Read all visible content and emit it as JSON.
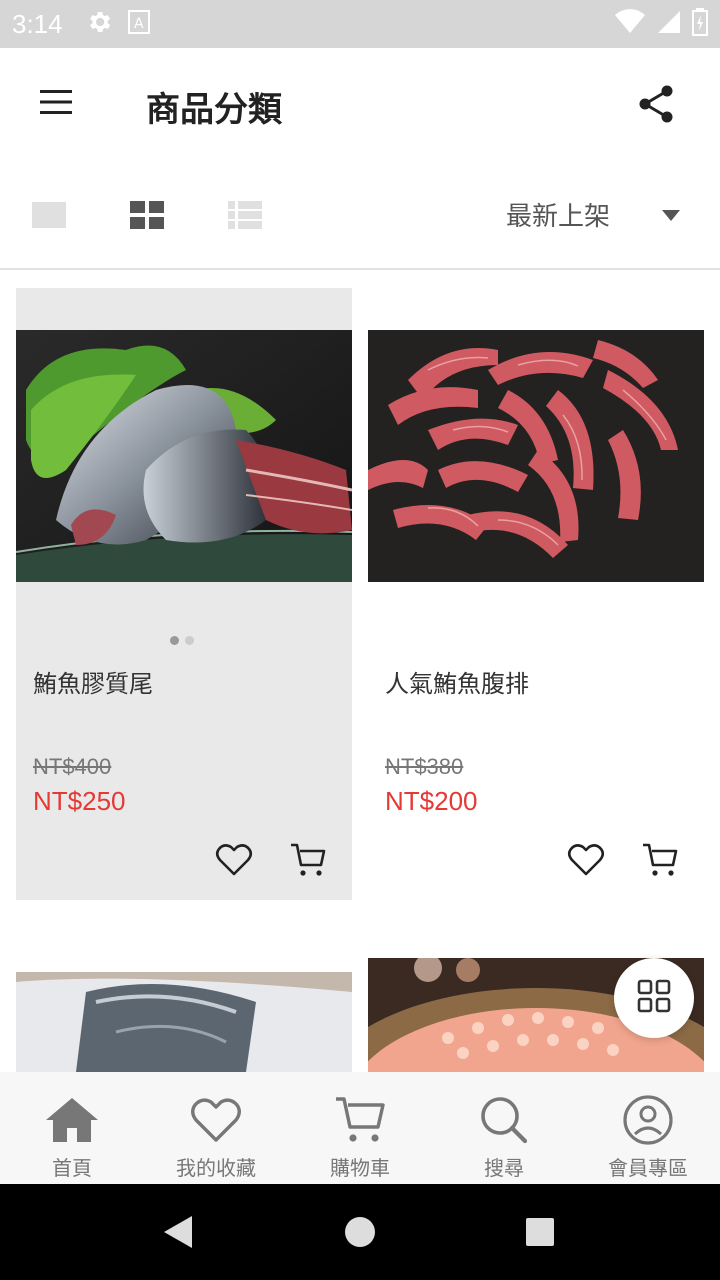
{
  "status_bar": {
    "time": "3:14",
    "icons_left": [
      "gear-icon",
      "font-a-icon"
    ],
    "icons_right": [
      "wifi-icon",
      "signal-icon",
      "battery-icon"
    ]
  },
  "app_bar": {
    "title": "商品分類",
    "menu_icon": "hamburger-menu-icon",
    "share_icon": "share-icon"
  },
  "view_toolbar": {
    "views": [
      "single-view-icon",
      "grid-view-icon",
      "list-view-icon"
    ],
    "selected_view": "grid-view-icon",
    "sort_label": "最新上架"
  },
  "products": [
    {
      "name": "鮪魚膠質尾",
      "original_price": "NT$400",
      "price": "NT$250",
      "image_pages": 2,
      "active_page": 1
    },
    {
      "name": "人氣鮪魚腹排",
      "original_price": "NT$380",
      "price": "NT$200"
    }
  ],
  "bottom_nav": {
    "items": [
      {
        "label": "首頁",
        "icon": "home-icon"
      },
      {
        "label": "我的收藏",
        "icon": "heart-icon"
      },
      {
        "label": "購物車",
        "icon": "cart-icon"
      },
      {
        "label": "搜尋",
        "icon": "search-icon"
      },
      {
        "label": "會員專區",
        "icon": "account-icon"
      }
    ]
  },
  "colors": {
    "price_red": "#e53935",
    "status_bar": "#d6d6d6",
    "nav_background": "#f7f7f7",
    "card_active_bg": "#e9e9e9"
  }
}
